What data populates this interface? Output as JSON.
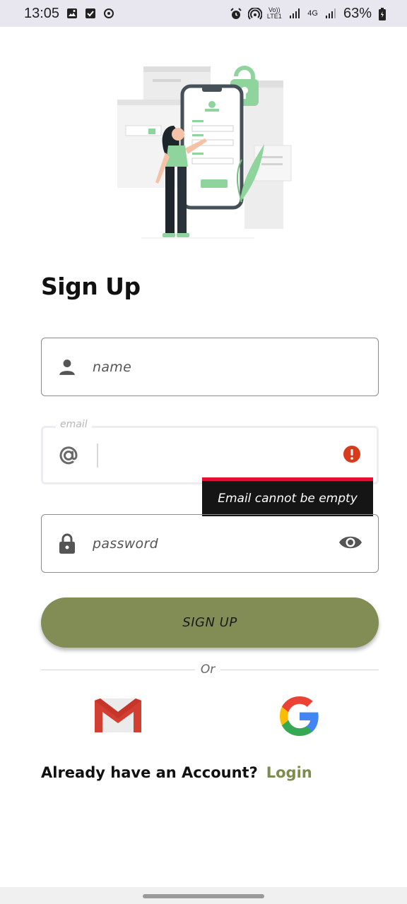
{
  "status_bar": {
    "time": "13:05",
    "battery_percent": "63%",
    "volte_label": "Vo)) LTE1",
    "network_label": "4G",
    "icons": [
      "image-icon",
      "checkbox-icon",
      "sync-icon",
      "alarm-icon",
      "hotspot-icon",
      "signal-icon",
      "signal-icon",
      "battery-icon"
    ]
  },
  "page": {
    "title": "Sign Up"
  },
  "form": {
    "name": {
      "placeholder": "name",
      "icon": "person-icon"
    },
    "email": {
      "label": "email",
      "value": "",
      "icon": "at-icon",
      "error_icon": "error-icon"
    },
    "password": {
      "placeholder": "password",
      "icon": "lock-icon",
      "toggle_icon": "eye-icon"
    },
    "error_message": "Email cannot be empty",
    "submit_label": "SIGN UP"
  },
  "divider_label": "Or",
  "social": {
    "gmail_icon": "gmail-icon",
    "google_icon": "google-icon"
  },
  "footer": {
    "question": "Already have an Account?",
    "login_label": "Login"
  },
  "colors": {
    "accent": "#818d54",
    "login": "#7c8b4e",
    "error": "#e0123c",
    "tooltip_bg": "#151515"
  }
}
